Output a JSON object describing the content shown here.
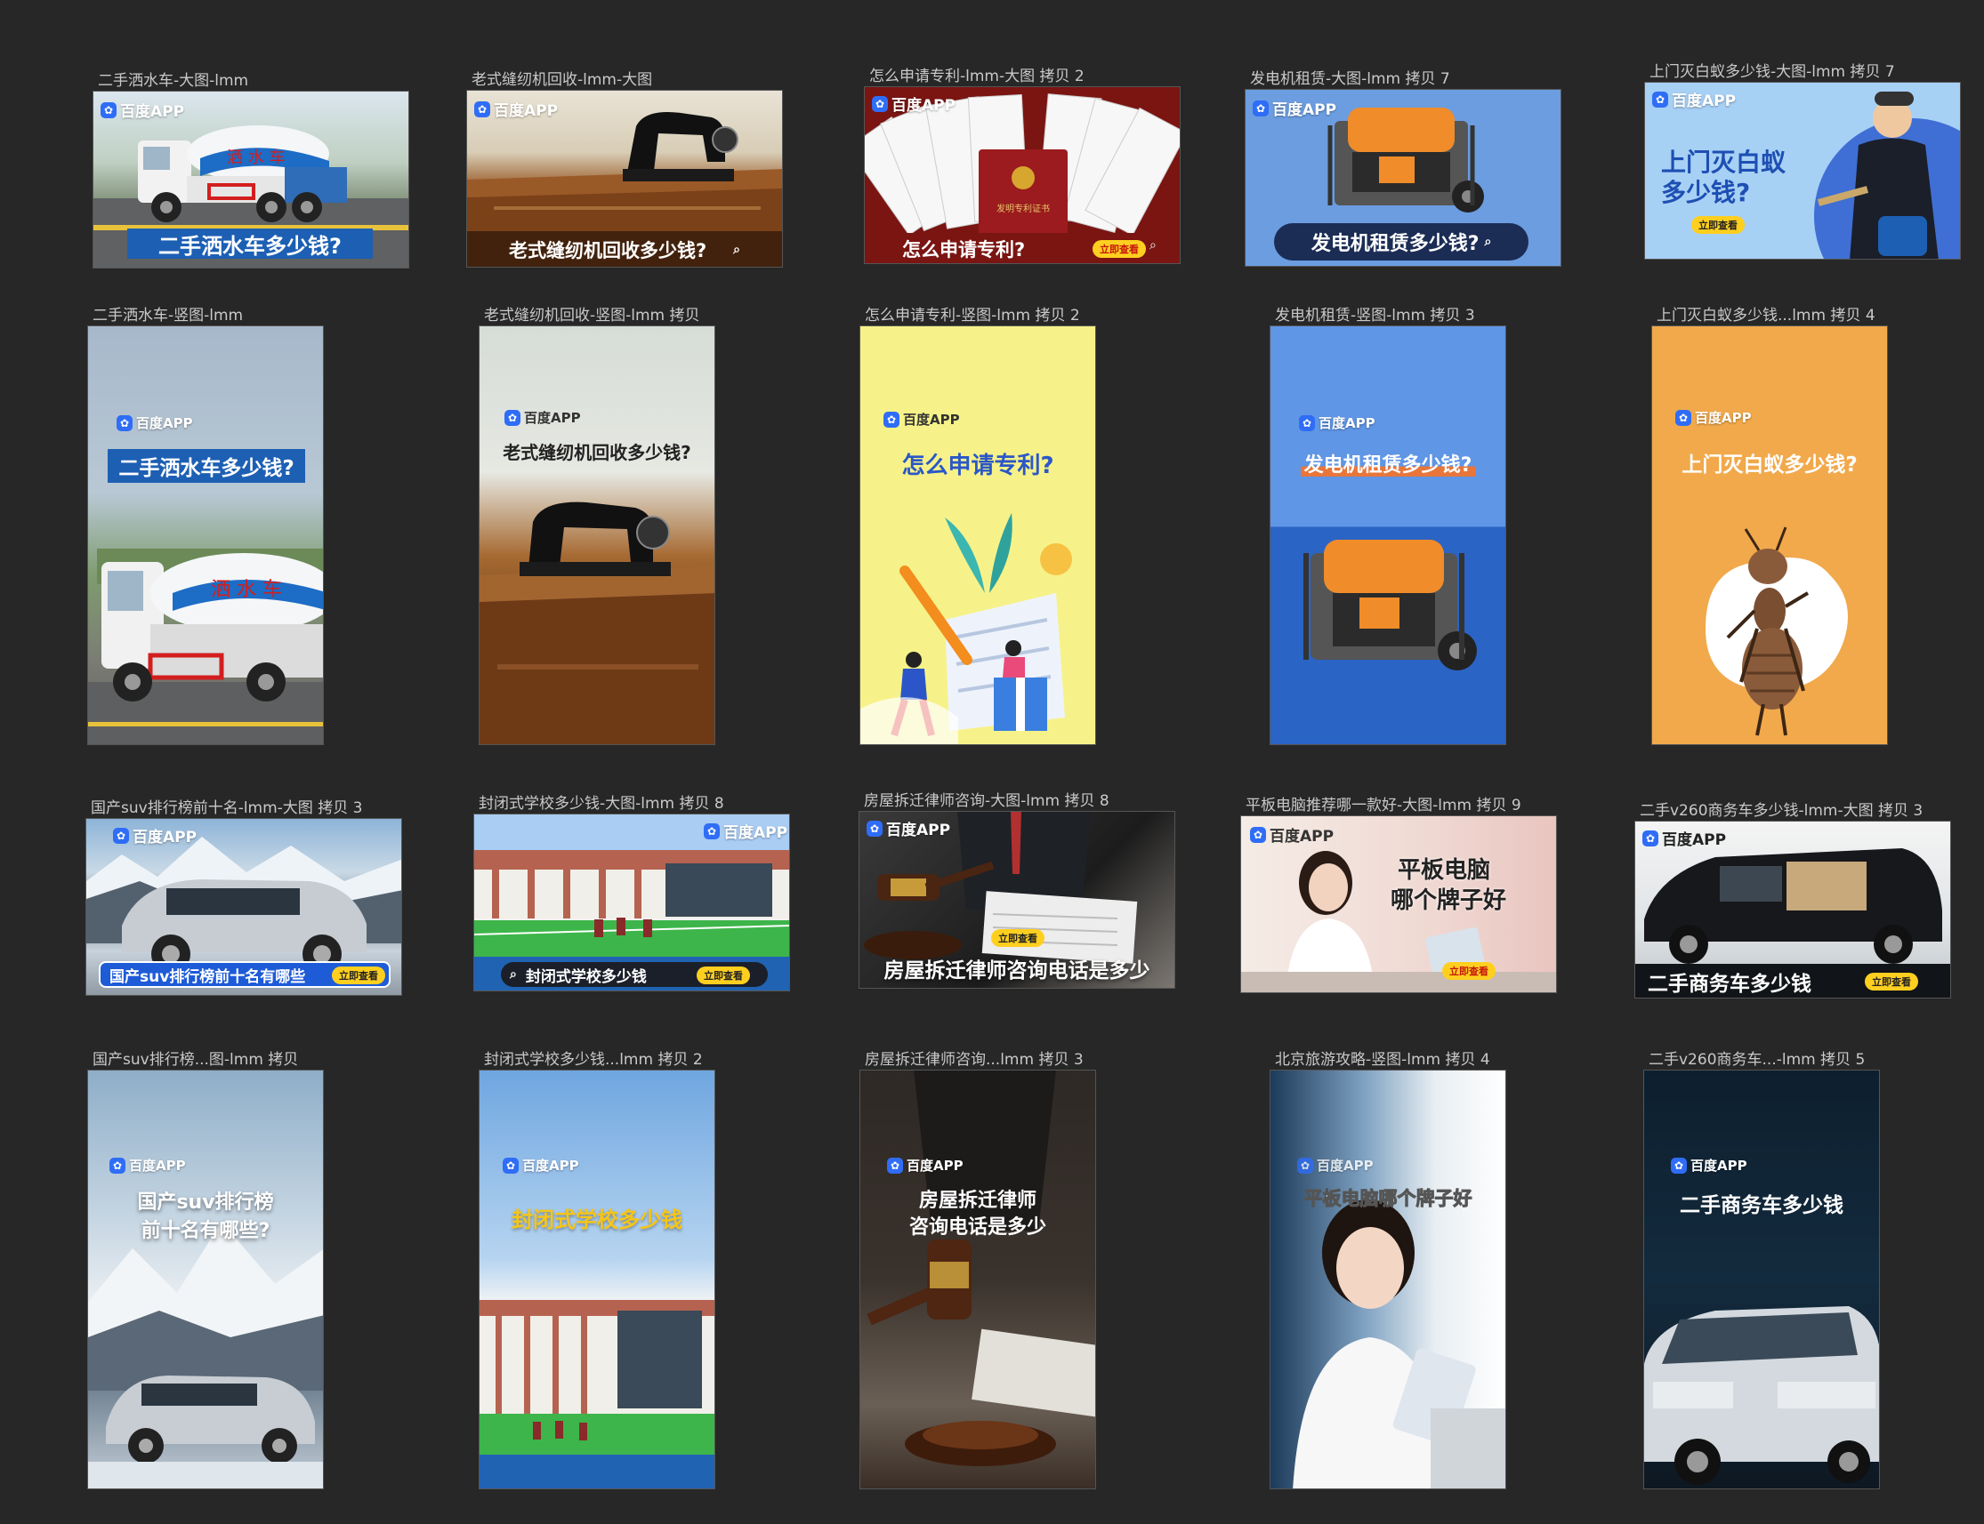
{
  "brand": "百度APP",
  "cta": "立即查看",
  "row1": [
    {
      "label": "二手洒水车-大图-lmm",
      "headline": "二手洒水车多少钱?"
    },
    {
      "label": "老式缝纫机回收-lmm-大图",
      "headline": "老式缝纫机回收多少钱?"
    },
    {
      "label": "怎么申请专利-lmm-大图 拷贝 2",
      "headline": "怎么申请专利?",
      "cert": "发明专利证书"
    },
    {
      "label": "发电机租赁-大图-lmm 拷贝 7",
      "headline": "发电机租赁多少钱?"
    },
    {
      "label": "上门灭白蚁多少钱-大图-lmm 拷贝 7",
      "headline_1": "上门灭白蚁",
      "headline_2": "多少钱?"
    }
  ],
  "row2": [
    {
      "label": "二手洒水车-竖图-lmm",
      "headline": "二手洒水车多少钱?",
      "truck_text": "洒 水 车"
    },
    {
      "label": "老式缝纫机回收-竖图-lmm 拷贝",
      "headline": "老式缝纫机回收多少钱?"
    },
    {
      "label": "怎么申请专利-竖图-lmm 拷贝 2",
      "headline": "怎么申请专利?"
    },
    {
      "label": "发电机租赁-竖图-lmm 拷贝 3",
      "headline": "发电机租赁多少钱?"
    },
    {
      "label": "上门灭白蚁多少钱...lmm 拷贝 4",
      "headline": "上门灭白蚁多少钱?"
    }
  ],
  "row3": [
    {
      "label": "国产suv排行榜前十名-lmm-大图 拷贝 3",
      "headline": "国产suv排行榜前十名有哪些"
    },
    {
      "label": "封闭式学校多少钱-大图-lmm 拷贝 8",
      "headline": "封闭式学校多少钱"
    },
    {
      "label": "房屋拆迁律师咨询-大图-lmm 拷贝 8",
      "headline": "房屋拆迁律师咨询电话是多少"
    },
    {
      "label": "平板电脑推荐哪一款好-大图-lmm 拷贝 9",
      "headline_1": "平板电脑",
      "headline_2": "哪个牌子好"
    },
    {
      "label": "二手v260商务车多少钱-lmm-大图 拷贝 3",
      "headline": "二手商务车多少钱"
    }
  ],
  "row4": [
    {
      "label": "国产suv排行榜...图-lmm 拷贝",
      "headline_1": "国产suv排行榜",
      "headline_2": "前十名有哪些?"
    },
    {
      "label": "封闭式学校多少钱...lmm 拷贝 2",
      "headline": "封闭式学校多少钱"
    },
    {
      "label": "房屋拆迁律师咨询...lmm 拷贝 3",
      "headline_1": "房屋拆迁律师",
      "headline_2": "咨询电话是多少"
    },
    {
      "label": "北京旅游攻略-竖图-lmm 拷贝 4",
      "headline": "平板电脑哪个牌子好"
    },
    {
      "label": "二手v260商务车...-lmm 拷贝 5",
      "headline": "二手商务车多少钱"
    }
  ],
  "colors": {
    "canvas": "#272727",
    "baidu_blue": "#2f6df6",
    "cta_yellow": "#ffcf1f",
    "bar_blue": "#1d5fb3"
  }
}
